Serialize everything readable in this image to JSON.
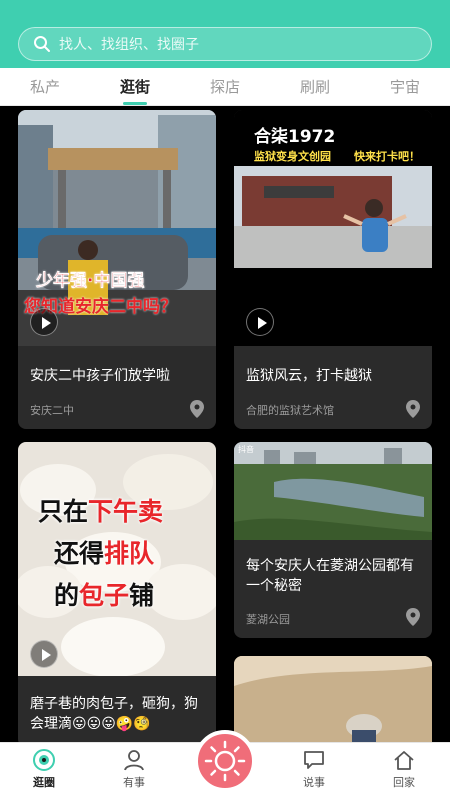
{
  "search": {
    "placeholder": "找人、找组织、找圈子"
  },
  "tabs": [
    {
      "label": "私产",
      "active": false
    },
    {
      "label": "逛街",
      "active": true
    },
    {
      "label": "探店",
      "active": false
    },
    {
      "label": "刷刷",
      "active": false
    },
    {
      "label": "宇宙",
      "active": false
    }
  ],
  "cards": [
    {
      "title": "安庆二中孩子们放学啦",
      "location": "安庆二中",
      "overlay": [
        "少年强·中国强",
        "您知道安庆二中吗？"
      ]
    },
    {
      "title": "监狱风云，打卡越狱",
      "location": "合肥的监狱艺术馆",
      "overlay": [
        "合柒1972",
        "监狱变身文创园",
        "快来打卡吧！"
      ]
    },
    {
      "title": "磨子巷的肉包子，砸狗，狗会理滴😛😛😛🤪🧐",
      "location": "",
      "overlay_lines": [
        {
          "prefix": "只在",
          "highlight": "下午卖",
          "suffix": ""
        },
        {
          "prefix": "还得",
          "highlight": "排队",
          "suffix": ""
        },
        {
          "prefix": "的",
          "highlight": "包子",
          "suffix": "铺"
        }
      ]
    },
    {
      "title": "每个安庆人在菱湖公园都有一个秘密",
      "location": "菱湖公园",
      "overlay": [
        "抖音"
      ]
    },
    {
      "title": "",
      "location": "",
      "overlay": []
    }
  ],
  "nav": [
    {
      "label": "逛圈",
      "icon": "eye-icon",
      "active": true
    },
    {
      "label": "有事",
      "icon": "person-icon",
      "active": false
    },
    {
      "label": "",
      "icon": "sun-icon",
      "active": false
    },
    {
      "label": "说事",
      "icon": "chat-icon",
      "active": false
    },
    {
      "label": "回家",
      "icon": "home-icon",
      "active": false
    }
  ],
  "colors": {
    "accent": "#3fcfb0",
    "center_button": "#f06d79",
    "card_bg": "#2b2b2b",
    "overlay_red": "#e8262b",
    "overlay_yellow": "#ffe14a"
  }
}
